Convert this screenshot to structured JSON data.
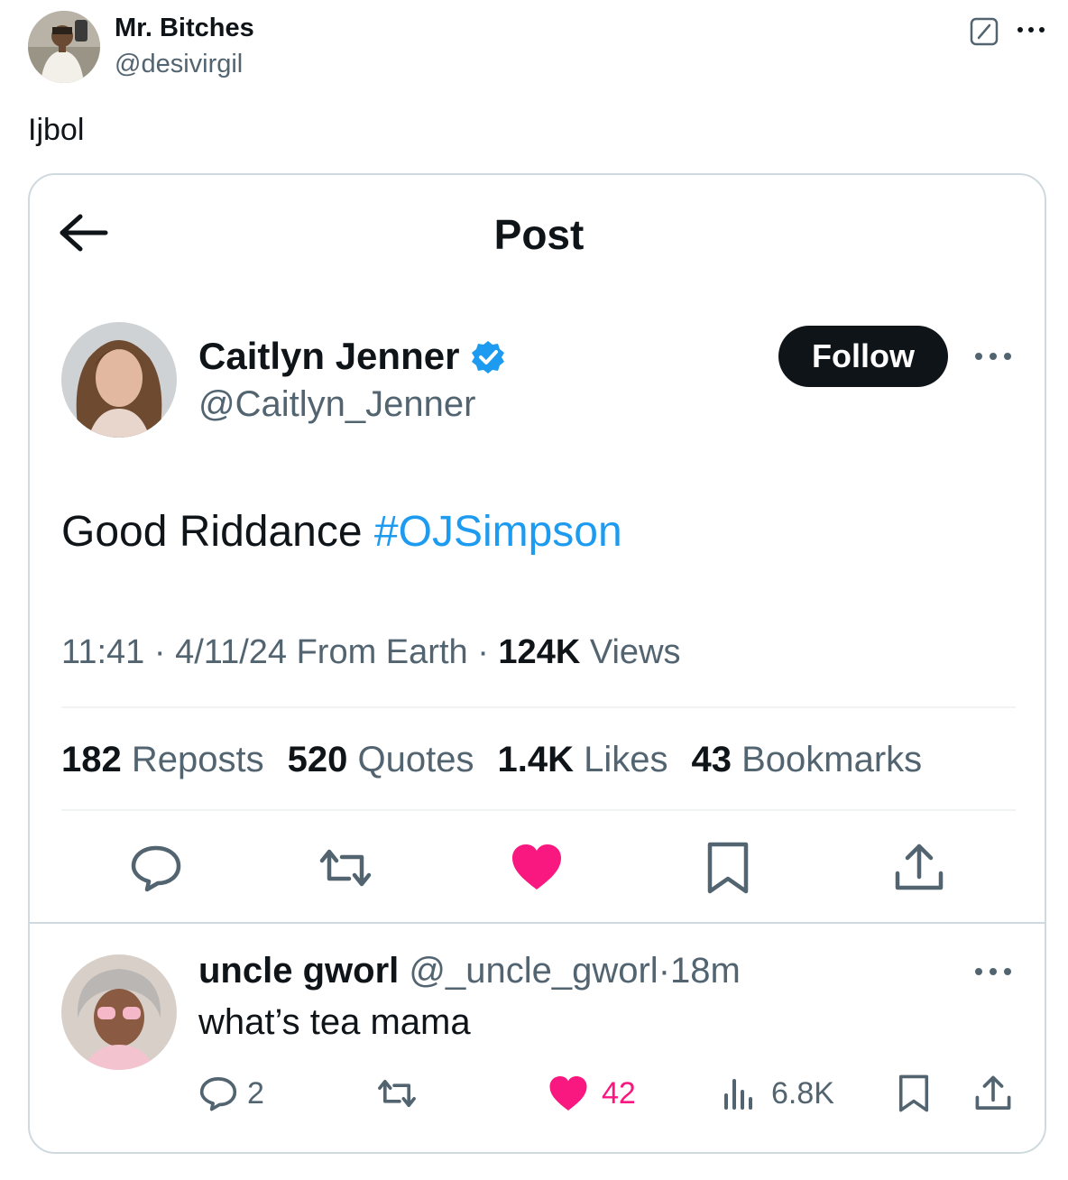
{
  "outer": {
    "display_name": "Mr. Bitches",
    "handle": "@desivirgil",
    "text": "Ijbol"
  },
  "quoted": {
    "header_title": "Post",
    "author": {
      "name": "Caitlyn Jenner",
      "handle": "@Caitlyn_Jenner",
      "verified": true
    },
    "follow_label": "Follow",
    "text": "Good Riddance",
    "hashtag": "#OJSimpson",
    "meta": {
      "time": "11:41",
      "date": "4/11/24",
      "source": "From Earth",
      "views_count": "124K",
      "views_label": "Views"
    },
    "stats": {
      "reposts_count": "182",
      "reposts_label": "Reposts",
      "quotes_count": "520",
      "quotes_label": "Quotes",
      "likes_count": "1.4K",
      "likes_label": "Likes",
      "bookmarks_count": "43",
      "bookmarks_label": "Bookmarks"
    }
  },
  "reply": {
    "name": "uncle gworl",
    "handle": "@_uncle_gworl",
    "sep": "·",
    "time": "18m",
    "text": "what’s tea mama",
    "replies": "2",
    "likes": "42",
    "views": "6.8K"
  },
  "colors": {
    "accent": "#1d9bf0",
    "like": "#f91880",
    "text": "#0f1419",
    "muted": "#536471",
    "border": "#cfd9de"
  },
  "icons": [
    "edit-icon",
    "more-icon",
    "back-arrow-icon",
    "verified-badge-icon",
    "reply-icon",
    "repost-icon",
    "like-icon",
    "bookmark-icon",
    "share-icon",
    "views-icon"
  ]
}
